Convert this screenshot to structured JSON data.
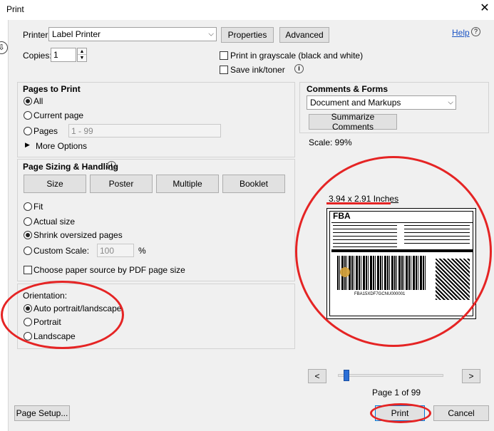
{
  "window": {
    "title": "Print",
    "close_glyph": "✕"
  },
  "printer": {
    "label": "Printer:",
    "value": "Label Printer",
    "properties": "Properties",
    "advanced": "Advanced",
    "help": "Help",
    "copies_label": "Copies:",
    "copies_value": "1",
    "grayscale": "Print in grayscale (black and white)",
    "save_ink": "Save ink/toner"
  },
  "pages_to_print": {
    "title": "Pages to Print",
    "all": "All",
    "current": "Current page",
    "pages": "Pages",
    "pages_value": "1 - 99",
    "more_options": "More Options"
  },
  "sizing": {
    "title": "Page Sizing & Handling",
    "tabs": [
      "Size",
      "Poster",
      "Multiple",
      "Booklet"
    ],
    "fit": "Fit",
    "actual": "Actual size",
    "shrink": "Shrink oversized pages",
    "custom": "Custom Scale:",
    "custom_value": "100",
    "percent": "%",
    "paper_source": "Choose paper source by PDF page size"
  },
  "orientation": {
    "title": "Orientation:",
    "auto": "Auto portrait/landscape",
    "portrait": "Portrait",
    "landscape": "Landscape"
  },
  "comments": {
    "title": "Comments & Forms",
    "value": "Document and Markups",
    "summarize": "Summarize Comments"
  },
  "preview": {
    "scale": "Scale:  99%",
    "size": "3.94 x 2.91 Inches",
    "label_header": "FBA",
    "barcode_text": "FBA15XDF7GCNU000001",
    "page_info": "Page 1 of 99",
    "prev": "<",
    "next": ">",
    "slider_value": 0.01
  },
  "footer": {
    "page_setup": "Page Setup...",
    "print": "Print",
    "cancel": "Cancel"
  },
  "colors": {
    "annotation_red": "#e52424",
    "link_blue": "#1a54c4",
    "slider_blue": "#2b6fd6"
  }
}
